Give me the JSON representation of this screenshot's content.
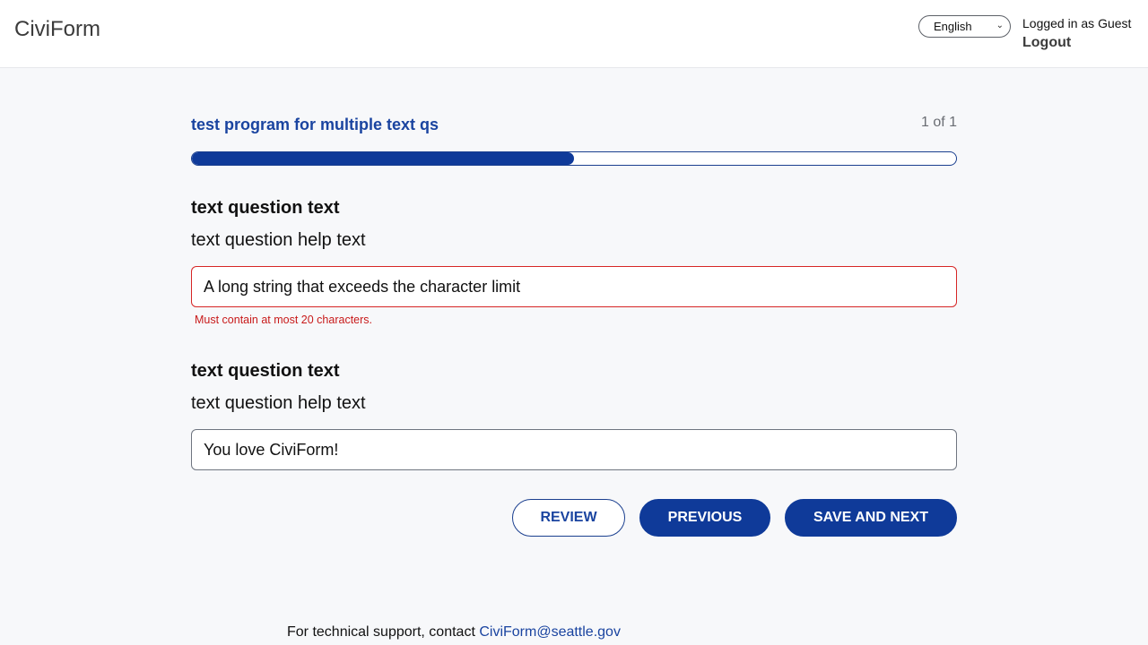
{
  "header": {
    "brand": "CiviForm",
    "language_selected": "English",
    "logged_in_text": "Logged in as Guest",
    "logout_label": "Logout"
  },
  "program": {
    "title": "test program for multiple text qs",
    "step_count": "1 of 1",
    "progress_fraction": 0.5
  },
  "questions": [
    {
      "title": "text question text",
      "help": "text question help text",
      "value": "A long string that exceeds the character limit",
      "error": "Must contain at most 20 characters."
    },
    {
      "title": "text question text",
      "help": "text question help text",
      "value": "You love CiviForm!"
    }
  ],
  "buttons": {
    "review": "REVIEW",
    "previous": "PREVIOUS",
    "save_next": "SAVE AND NEXT"
  },
  "footer": {
    "text": "For technical support, contact ",
    "email": "CiviForm@seattle.gov"
  },
  "colors": {
    "accent": "#0f3a99",
    "error": "#d62626"
  }
}
